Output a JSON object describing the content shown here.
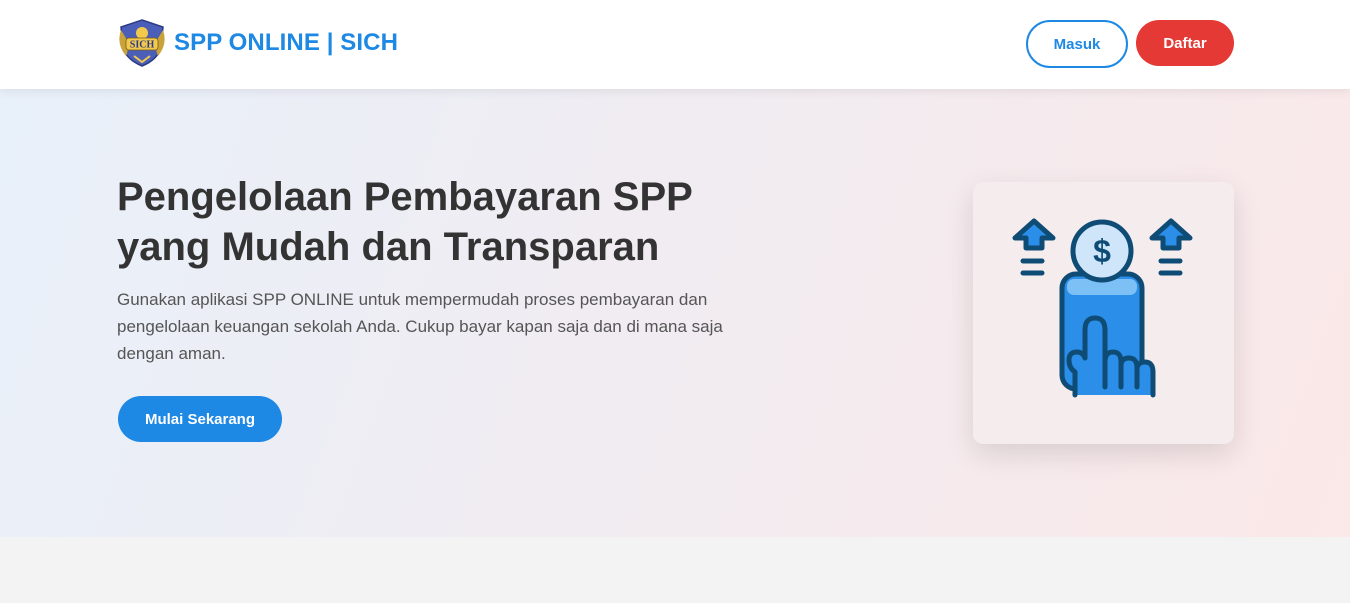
{
  "navbar": {
    "brand_name": "SPP ONLINE | SICH",
    "logo_text": "SICH",
    "login_label": "Masuk",
    "register_label": "Daftar"
  },
  "hero": {
    "title_line1": "Pengelolaan Pembayaran SPP",
    "title_line2": "yang Mudah dan Transparan",
    "description": "Gunakan aplikasi SPP ONLINE untuk mempermudah proses pembayaran dan pengelolaan keuangan sekolah Anda. Cukup bayar kapan saja dan di mana saja dengan aman.",
    "cta_label": "Mulai Sekarang",
    "illustration_icon": "coin-payment-phone-hand-icon",
    "coin_symbol": "$"
  },
  "colors": {
    "primary": "#1e88e5",
    "danger": "#e53935",
    "text_dark": "#333333",
    "text_muted": "#555555",
    "icon_stroke": "#0f4c75"
  }
}
